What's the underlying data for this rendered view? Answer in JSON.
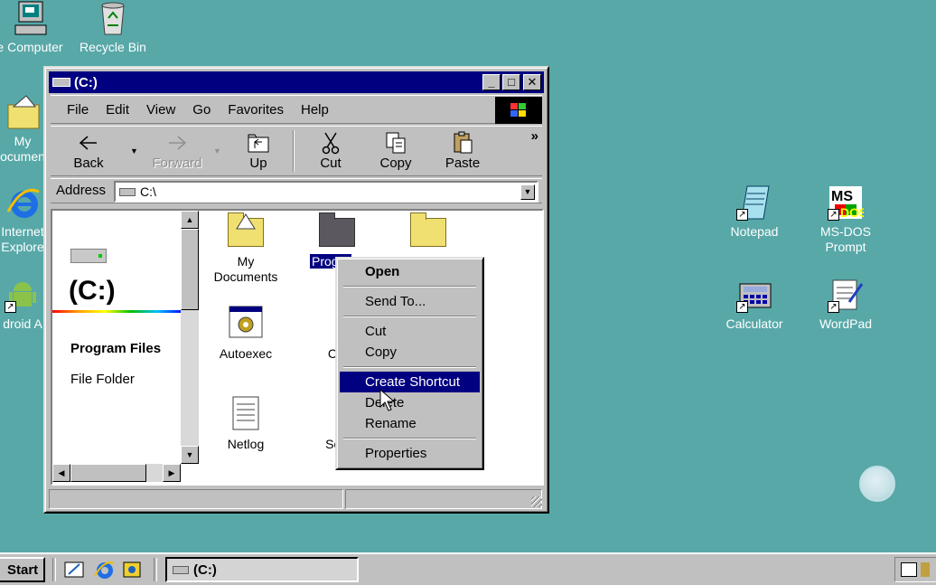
{
  "desktop": {
    "icons": [
      {
        "label": "e Computer"
      },
      {
        "label": "Recycle Bin"
      },
      {
        "label": "My",
        "label2": "ocumen"
      },
      {
        "label": "Internet",
        "label2": "Explore"
      },
      {
        "label": "droid A"
      },
      {
        "label": "Notepad"
      },
      {
        "label": "MS-DOS",
        "label2": "Prompt"
      },
      {
        "label": "Calculator"
      },
      {
        "label": "WordPad"
      }
    ]
  },
  "window": {
    "title": "(C:)",
    "menu": [
      "File",
      "Edit",
      "View",
      "Go",
      "Favorites",
      "Help"
    ],
    "toolbar": {
      "back": "Back",
      "forward": "Forward",
      "up": "Up",
      "cut": "Cut",
      "copy": "Copy",
      "paste": "Paste",
      "more": "»"
    },
    "address": {
      "label": "Address",
      "value": "C:\\"
    },
    "left_pane": {
      "drive_title": "(C:)",
      "selected_name": "Program Files",
      "selected_type": "File Folder"
    },
    "files": [
      {
        "label": "My",
        "label2": "Documents"
      },
      {
        "label": "Progra"
      },
      {
        "label": ""
      },
      {
        "label": "Autoexec"
      },
      {
        "label": "Comr"
      },
      {
        "label": "Netlog"
      },
      {
        "label": "Scand"
      }
    ]
  },
  "context_menu": {
    "items": [
      "Open",
      "Send To...",
      "Cut",
      "Copy",
      "Create Shortcut",
      "Delete",
      "Rename",
      "Properties"
    ],
    "highlighted": "Create Shortcut"
  },
  "taskbar": {
    "start": "Start",
    "task": "(C:)"
  },
  "colors": {
    "desktop": "#58a8a8",
    "titlebar": "#000080",
    "face": "#c0c0c0"
  }
}
